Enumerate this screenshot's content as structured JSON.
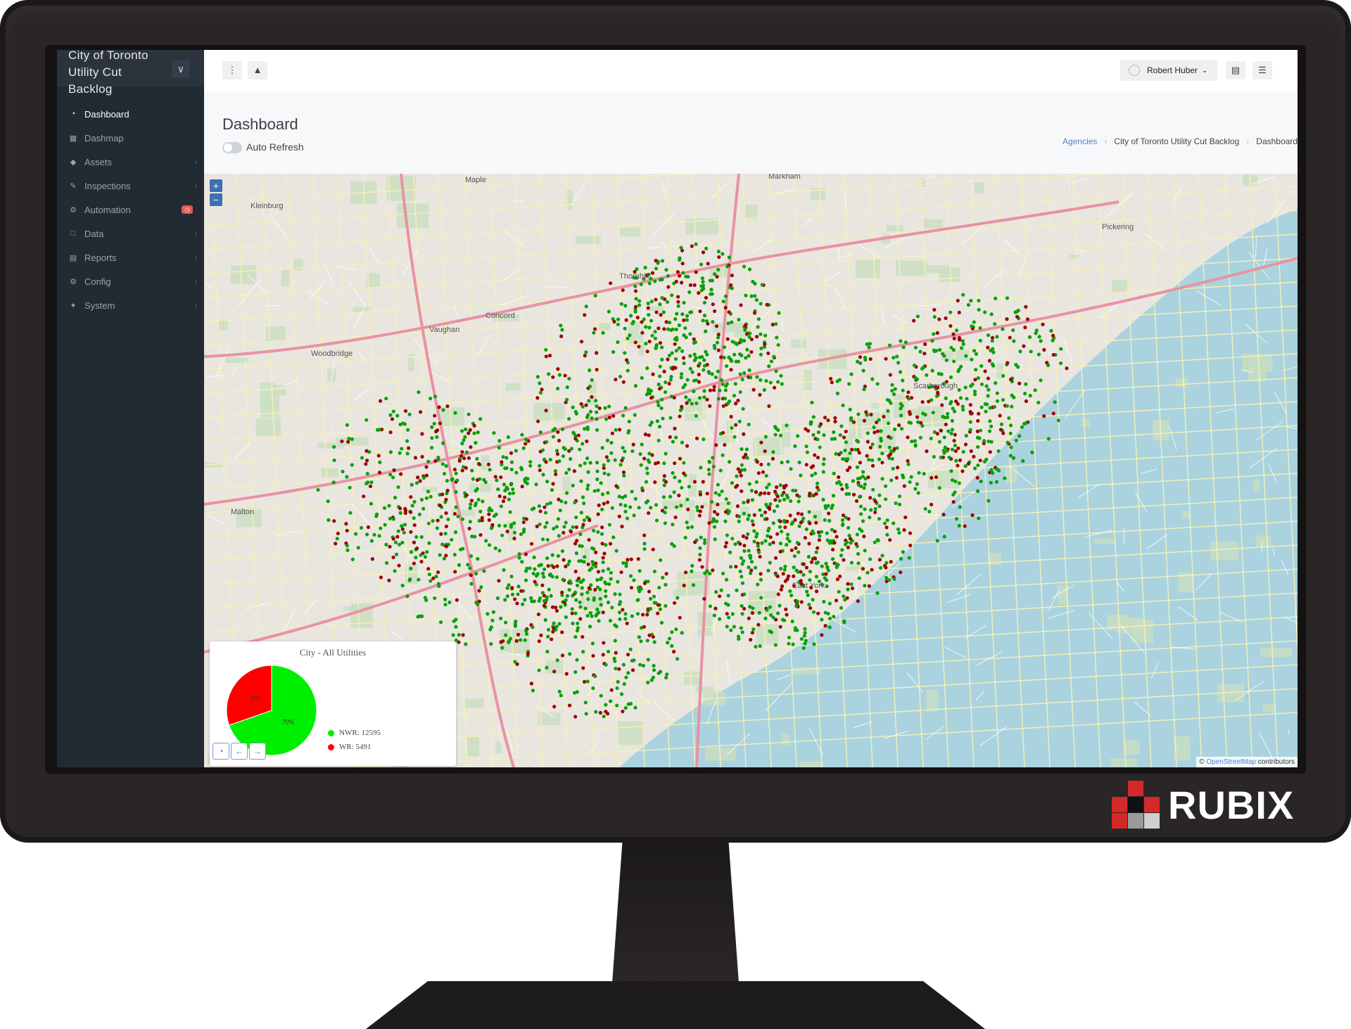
{
  "sidebar": {
    "title": "City of Toronto Utility Cut Backlog",
    "items": [
      {
        "label": "Dashboard",
        "icon": "gauge-icon",
        "active": true
      },
      {
        "label": "Dashmap",
        "icon": "map-icon"
      },
      {
        "label": "Assets",
        "icon": "diamond-icon"
      },
      {
        "label": "Inspections",
        "icon": "edit-icon"
      },
      {
        "label": "Automation",
        "icon": "gear-icon"
      },
      {
        "label": "Data",
        "icon": "folder-icon"
      },
      {
        "label": "Reports",
        "icon": "chart-icon"
      },
      {
        "label": "Config",
        "icon": "cog-icon"
      },
      {
        "label": "System",
        "icon": "wrench-icon"
      }
    ]
  },
  "topbar": {
    "user_name": "Robert Huber"
  },
  "page": {
    "title": "Dashboard",
    "auto_refresh_label": "Auto Refresh",
    "breadcrumb": [
      "Agencies",
      "City of Toronto Utility Cut Backlog",
      "Dashboard"
    ]
  },
  "map": {
    "places": [
      "Markham",
      "Maple",
      "Kleinburg",
      "Thornhill",
      "Concord",
      "Vaughan",
      "Woodbridge",
      "Pickering",
      "Malton",
      "East York",
      "Scarborough"
    ],
    "attribution_prefix": "©",
    "attribution_link": "OpenStreetMap",
    "attribution_suffix": " contributors",
    "dot_colors": {
      "nwr": "#0aa00a",
      "wr": "#a00000"
    }
  },
  "chart_data": {
    "type": "pie",
    "title": "City - All Utilities",
    "slices": [
      {
        "label": "NWR",
        "value": 12595,
        "percent_label": "70%",
        "color": "#00ee00"
      },
      {
        "label": "WR",
        "value": 5491,
        "percent_label": "30%",
        "color": "#ff0000"
      }
    ],
    "legend": [
      {
        "text": "NWR: 12595",
        "color": "#00ee00"
      },
      {
        "text": "WR: 5491",
        "color": "#ff0000"
      }
    ],
    "legend_position": "right"
  },
  "brand": {
    "name": "RUBIX"
  }
}
